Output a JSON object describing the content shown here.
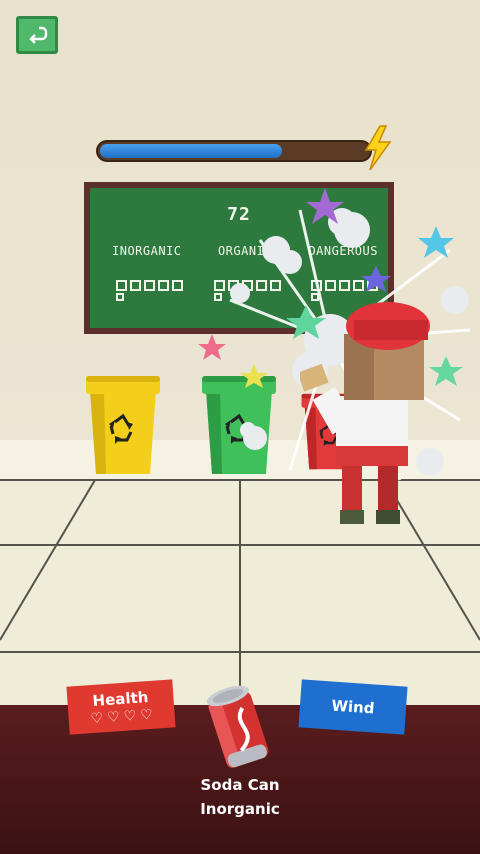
{
  "game": {
    "score": "72",
    "energy_fraction": 0.68,
    "categories": [
      "INORGANIC",
      "ORGANIC",
      "DANGEROUS"
    ],
    "category_counts": [
      1,
      1,
      1
    ]
  },
  "bins": [
    {
      "name": "yellow-bin",
      "color": "#f3cf1c",
      "shade": "#d9b30f",
      "icon": "recycle-icon"
    },
    {
      "name": "green-bin",
      "color": "#3fc05a",
      "shade": "#2c9c45",
      "icon": "recycle-icon"
    },
    {
      "name": "red-bin",
      "color": "#e23a3a",
      "shade": "#bf2727",
      "icon": "recycle-icon"
    }
  ],
  "hud": {
    "health_label": "Health",
    "health_hearts": 4,
    "wind_label": "Wind"
  },
  "item": {
    "name": "Soda Can",
    "type": "Inorganic"
  },
  "colors": {
    "board": "#2e7a3e",
    "board_frame": "#5b2f2a",
    "energy": "#1f6ec8",
    "health_card": "#e0392f",
    "wind_card": "#1e6fd0",
    "desk": "#4a1618"
  }
}
